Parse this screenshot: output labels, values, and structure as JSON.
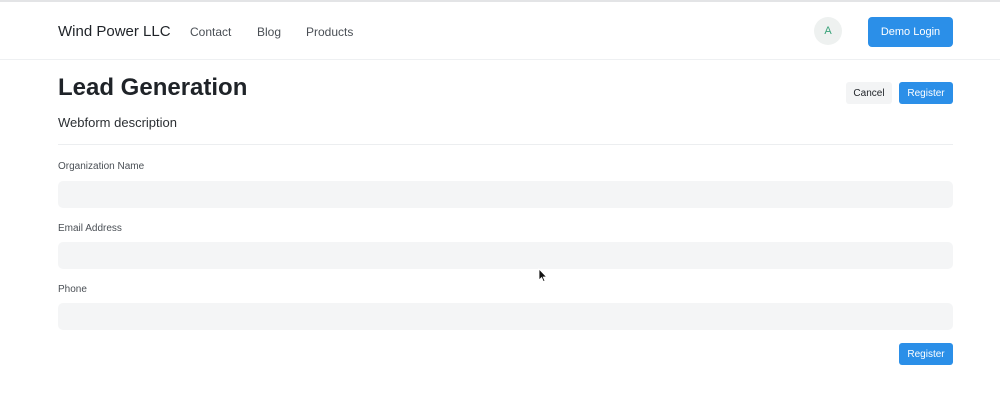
{
  "nav": {
    "brand": "Wind Power LLC",
    "links": [
      "Contact",
      "Blog",
      "Products"
    ],
    "avatar_initial": "A",
    "demo_login_label": "Demo Login"
  },
  "form": {
    "title": "Lead Generation",
    "description": "Webform description",
    "cancel_label": "Cancel",
    "register_label": "Register",
    "fields": [
      {
        "label": "Organization Name",
        "value": ""
      },
      {
        "label": "Email Address",
        "value": ""
      },
      {
        "label": "Phone",
        "value": ""
      }
    ],
    "submit_label": "Register"
  },
  "colors": {
    "accent": "#2b8fe8",
    "input_bg": "#f4f5f6",
    "avatar_text": "#3aa37a"
  }
}
